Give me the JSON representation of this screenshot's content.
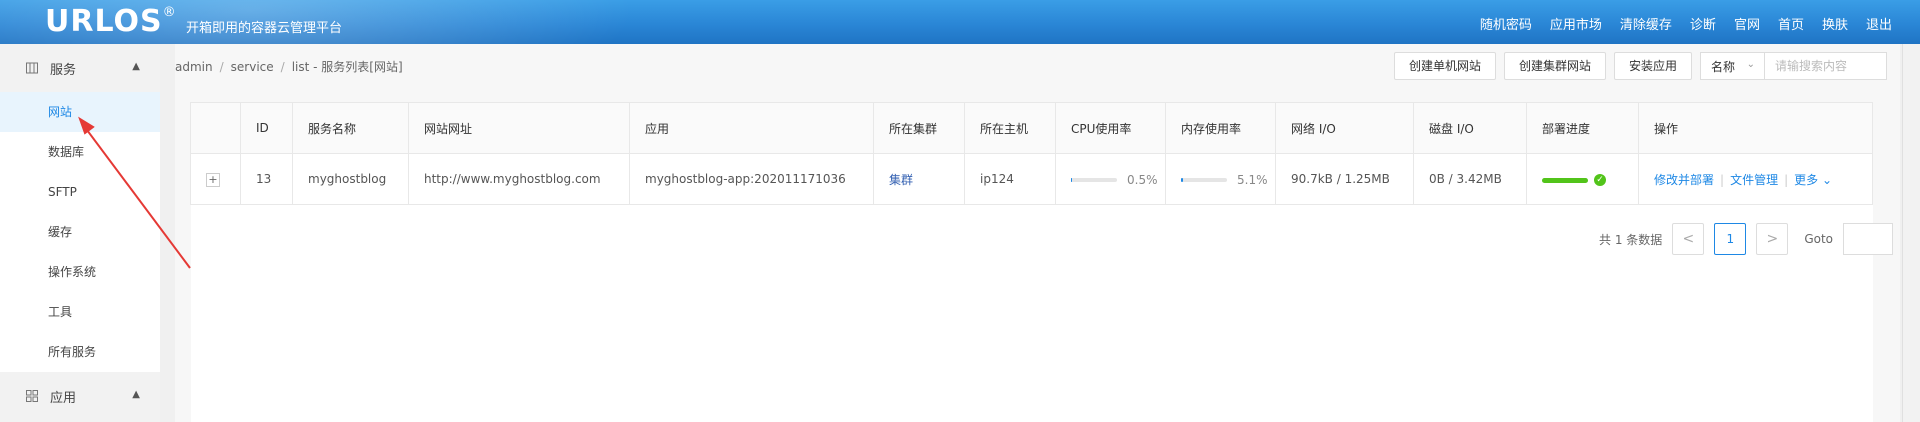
{
  "header": {
    "logo": "URLOS",
    "logo_mark": "®",
    "slogan": "开箱即用的容器云管理平台",
    "nav": [
      "随机密码",
      "应用市场",
      "清除缓存",
      "诊断",
      "官网",
      "首页",
      "换肤",
      "退出"
    ]
  },
  "sidebar": {
    "group1": {
      "label": "服务",
      "icon": "grid-icon"
    },
    "items": [
      {
        "label": "网站",
        "active": true
      },
      {
        "label": "数据库"
      },
      {
        "label": "SFTP"
      },
      {
        "label": "缓存"
      },
      {
        "label": "操作系统"
      },
      {
        "label": "工具"
      },
      {
        "label": "所有服务"
      }
    ],
    "group2": {
      "label": "应用",
      "icon": "apps-icon"
    }
  },
  "breadcrumb": [
    "admin",
    "service",
    "list - 服务列表[网站]"
  ],
  "toolbar": {
    "btn_single": "创建单机网站",
    "btn_cluster": "创建集群网站",
    "btn_install": "安装应用",
    "select_value": "名称",
    "search_placeholder": "请输搜索内容"
  },
  "table": {
    "columns": [
      "",
      "ID",
      "服务名称",
      "网站网址",
      "应用",
      "所在集群",
      "所在主机",
      "CPU使用率",
      "内存使用率",
      "网络 I/O",
      "磁盘 I/O",
      "部署进度",
      "操作"
    ],
    "rows": [
      {
        "expand": "+",
        "id": "13",
        "name": "myghostblog",
        "url": "http://www.myghostblog.com",
        "app": "myghostblog-app:202011171036",
        "cluster": "集群",
        "host": "ip124",
        "cpu": "0.5%",
        "cpu_pct": 0.5,
        "mem": "5.1%",
        "mem_pct": 5.1,
        "net": "90.7kB / 1.25MB",
        "disk": "0B / 3.42MB",
        "deploy_pct": 100,
        "ops": [
          "修改并部署",
          "文件管理",
          "更多"
        ]
      }
    ]
  },
  "pager": {
    "total": "共 1 条数据",
    "prev": "<",
    "current": "1",
    "next": ">",
    "goto": "Goto"
  },
  "colors": {
    "brand": "#2a86d6",
    "link": "#1e88e5",
    "success": "#52c41a",
    "annotation": "#e53935"
  }
}
